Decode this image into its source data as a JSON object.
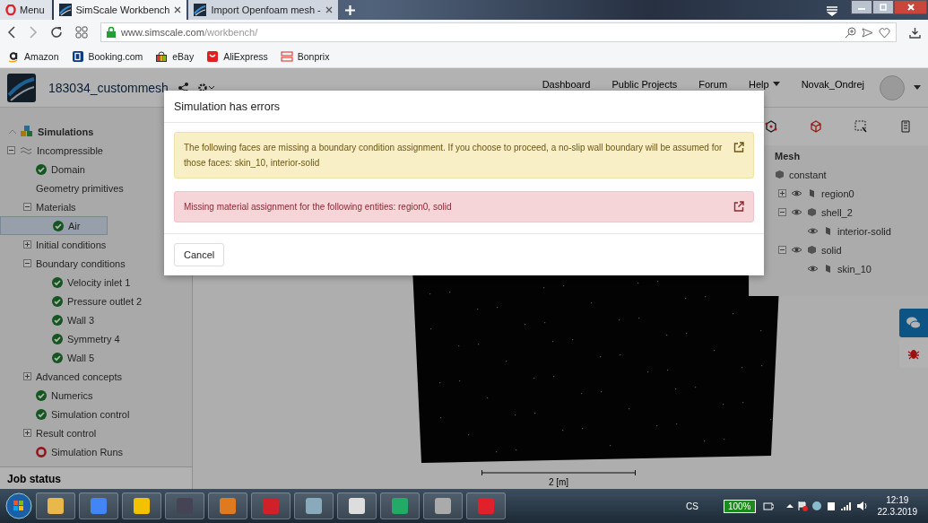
{
  "browser": {
    "menu_label": "Menu",
    "tabs": [
      {
        "title": "SimScale Workbench",
        "selected": true
      },
      {
        "title": "Import Openfoam mesh -",
        "selected": false
      }
    ],
    "url_host": "www.simscale.com",
    "url_path": "/workbench/",
    "bookmarks": [
      "Amazon",
      "Booking.com",
      "eBay",
      "AliExpress",
      "Bonprix"
    ]
  },
  "app": {
    "project_name": "183034_custommesh",
    "nav": [
      "Dashboard",
      "Public Projects",
      "Forum",
      "Help"
    ],
    "user": "Novak_Ondrej"
  },
  "sidebar": {
    "title": "Simulations",
    "tree": [
      {
        "label": "Incompressible",
        "expanded": true,
        "selected": false,
        "children": [
          {
            "label": "Domain",
            "valid": true,
            "selected": false
          },
          {
            "label": "Geometry primitives",
            "selected": false
          },
          {
            "label": "Materials",
            "expanded": true,
            "selected": false,
            "children": [
              {
                "label": "Air",
                "valid": true,
                "selected": true
              }
            ]
          },
          {
            "label": "Initial conditions",
            "expanded": false,
            "selected": false
          },
          {
            "label": "Boundary conditions",
            "expanded": true,
            "selected": false,
            "children": [
              {
                "label": "Velocity inlet 1",
                "valid": true,
                "selected": false
              },
              {
                "label": "Pressure outlet 2",
                "valid": true,
                "selected": false
              },
              {
                "label": "Wall 3",
                "valid": true,
                "selected": false
              },
              {
                "label": "Symmetry 4",
                "valid": true,
                "selected": false
              },
              {
                "label": "Wall 5",
                "valid": true,
                "selected": false
              }
            ]
          },
          {
            "label": "Advanced concepts",
            "expanded": false,
            "selected": false
          },
          {
            "label": "Numerics",
            "valid": true,
            "selected": false
          },
          {
            "label": "Simulation control",
            "valid": true,
            "selected": false
          },
          {
            "label": "Result control",
            "expanded": false,
            "selected": false
          },
          {
            "label": "Simulation Runs",
            "valid": false,
            "selected": false
          }
        ]
      }
    ],
    "job_status": "Job status"
  },
  "mesh_panel": {
    "title": "Mesh",
    "tree": [
      {
        "label": "constant",
        "children": [
          {
            "label": "region0",
            "expanded": false
          },
          {
            "label": "shell_2",
            "expanded": true,
            "children": [
              {
                "label": "interior-solid"
              }
            ]
          },
          {
            "label": "solid",
            "expanded": true,
            "children": [
              {
                "label": "skin_10"
              }
            ]
          }
        ]
      }
    ]
  },
  "viewport": {
    "scale_label": "2 [m]"
  },
  "modal": {
    "title": "Simulation has errors",
    "alerts": [
      {
        "kind": "warning",
        "text": "The following faces are missing a boundary condition assignment. If you choose to proceed, a no-slip wall boundary will be assumed for those faces: skin_10, interior-solid"
      },
      {
        "kind": "error",
        "text": "Missing material assignment for the following entities: region0, solid"
      }
    ],
    "buttons": [
      "Cancel"
    ]
  },
  "taskbar": {
    "language": "CS",
    "battery": "100%",
    "time": "12:19",
    "date": "22.3.2019"
  }
}
